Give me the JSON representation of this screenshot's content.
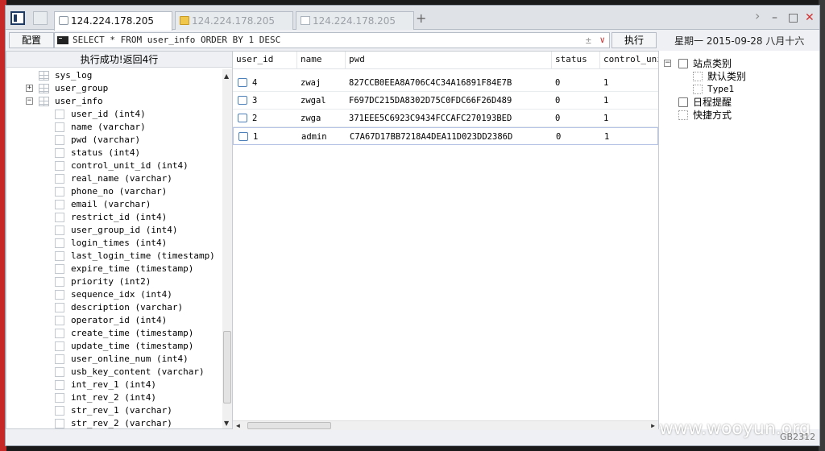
{
  "tabs": [
    {
      "label": "124.224.178.205",
      "icon": "page-icon",
      "active": true
    },
    {
      "label": "124.224.178.205",
      "icon": "folder-icon",
      "active": false
    },
    {
      "label": "124.224.178.205",
      "icon": "document-icon",
      "active": false
    }
  ],
  "tab_add_label": "+",
  "window_controls": {
    "chevron": "›",
    "minimize": "–",
    "maximize": "□",
    "close": "✕"
  },
  "toolbar": {
    "config_label": "配置",
    "sql": "SELECT * FROM user_info ORDER BY 1 DESC",
    "sql_plusminus": "±",
    "sql_dropdown": "∨",
    "execute_label": "执行",
    "date": "星期一 2015-09-28 八月十六"
  },
  "status_message": "执行成功!返回4行",
  "tree": {
    "tables": [
      {
        "name": "sys_log",
        "expander": ""
      },
      {
        "name": "user_group",
        "expander": "+"
      },
      {
        "name": "user_info",
        "expander": "−"
      }
    ],
    "columns": [
      "user_id (int4)",
      "name (varchar)",
      "pwd (varchar)",
      "status (int4)",
      "control_unit_id (int4)",
      "real_name (varchar)",
      "phone_no (varchar)",
      "email (varchar)",
      "restrict_id (int4)",
      "user_group_id (int4)",
      "login_times (int4)",
      "last_login_time (timestamp)",
      "expire_time (timestamp)",
      "priority (int2)",
      "sequence_idx (int4)",
      "description (varchar)",
      "operator_id (int4)",
      "create_time (timestamp)",
      "update_time (timestamp)",
      "user_online_num (int4)",
      "usb_key_content (varchar)",
      "int_rev_1 (int4)",
      "int_rev_2 (int4)",
      "str_rev_1 (varchar)",
      "str_rev_2 (varchar)"
    ]
  },
  "grid": {
    "headers": [
      "user_id",
      "name",
      "pwd",
      "status",
      "control_uni"
    ],
    "rows": [
      [
        "4",
        "zwaj",
        "827CCB0EEA8A706C4C34A16891F84E7B",
        "0",
        "1"
      ],
      [
        "3",
        "zwgal",
        "F697DC215DA8302D75C0FDC66F26D489",
        "0",
        "1"
      ],
      [
        "2",
        "zwga",
        "371EEE5C6923C9434FCCAFC270193BED",
        "0",
        "1"
      ],
      [
        "1",
        "admin",
        "C7A67D17BB7218A4DEA11D023DD2386D",
        "0",
        "1"
      ]
    ],
    "selected_row": 3
  },
  "right_tree": {
    "root": "站点类别",
    "root_expander": "−",
    "children": [
      "默认类别",
      "Type1"
    ],
    "schedule": "日程提醒",
    "shortcuts": "快捷方式"
  },
  "watermark": "www.wooyun.org",
  "encoding": "GB2312",
  "colors": {
    "accent": "#1e3b66",
    "close": "#d32f2f",
    "folder": "#f0c74a"
  }
}
